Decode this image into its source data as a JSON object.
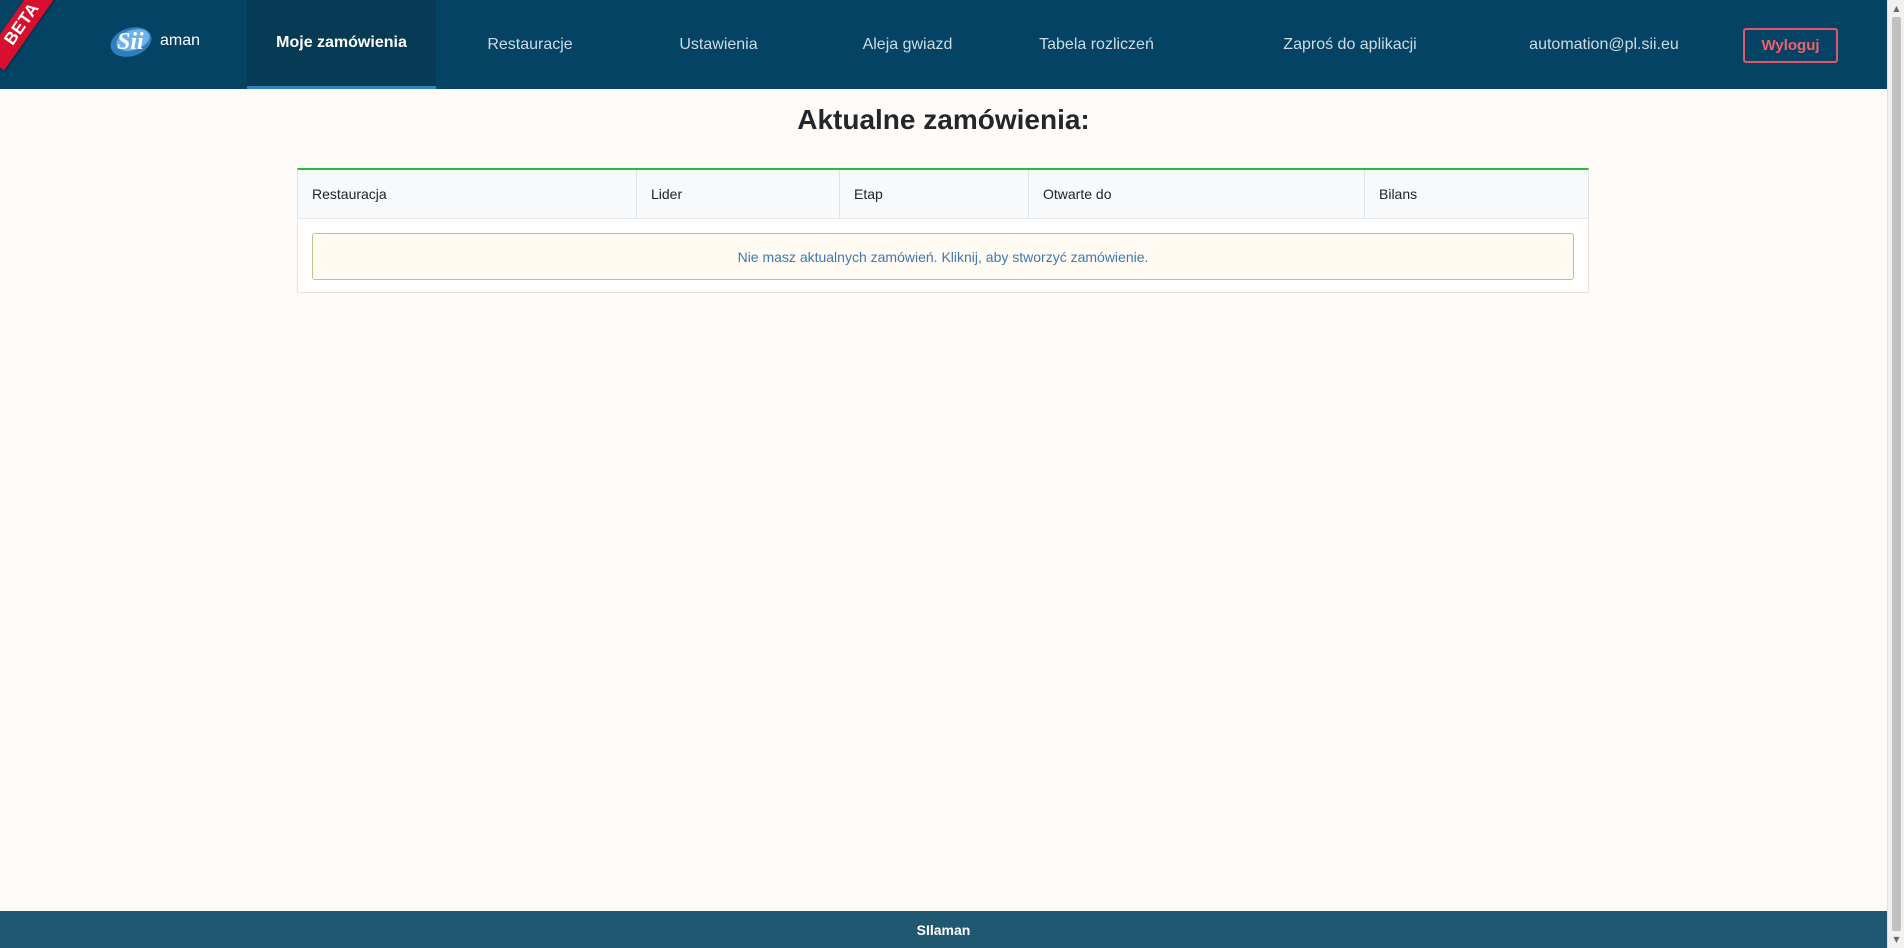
{
  "navbar": {
    "beta_label": "BETA",
    "logo_text": "aman",
    "items": [
      {
        "label": "Moje zamówienia",
        "active": true
      },
      {
        "label": "Restauracje",
        "active": false
      },
      {
        "label": "Ustawienia",
        "active": false
      },
      {
        "label": "Aleja gwiazd",
        "active": false
      },
      {
        "label": "Tabela rozliczeń",
        "active": false
      },
      {
        "label": "Zaproś do aplikacji",
        "active": false
      }
    ],
    "user_email": "automation@pl.sii.eu",
    "logout_label": "Wyloguj"
  },
  "main": {
    "title": "Aktualne zamówienia:",
    "table": {
      "columns": [
        "Restauracja",
        "Lider",
        "Etap",
        "Otwarte do",
        "Bilans"
      ],
      "empty_message": "Nie masz aktualnych zamówień. Kliknij, aby stworzyć zamówienie."
    }
  },
  "footer": {
    "text": "SIlaman"
  },
  "colors": {
    "navbar_bg": "#044364",
    "active_nav_bg": "#063a55",
    "table_accent": "#29b745",
    "logout_accent": "#e2566a",
    "footer_bg": "#205771",
    "page_bg": "#fffbf8"
  },
  "icons": {
    "logo": "sii-logo-icon",
    "scroll_up": "triangle-up-icon",
    "scroll_down": "triangle-down-icon"
  }
}
